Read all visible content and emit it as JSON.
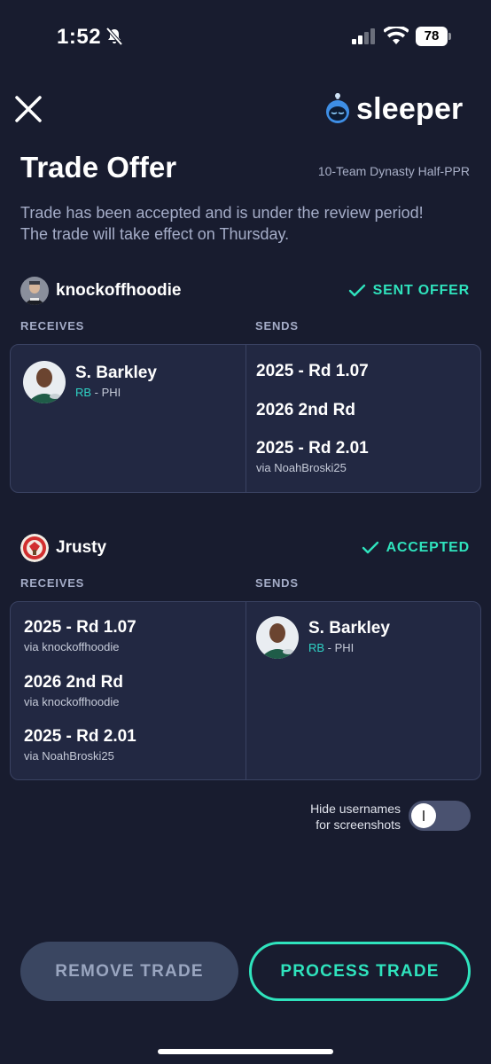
{
  "status_bar": {
    "time": "1:52",
    "battery": "78"
  },
  "header": {
    "logo_text": "sleeper"
  },
  "page": {
    "title": "Trade Offer",
    "league": "10-Team Dynasty Half-PPR",
    "message": "Trade has been accepted and is under the review period! The trade will take effect on Thursday."
  },
  "team1": {
    "name": "knockoffhoodie",
    "status": "SENT OFFER",
    "receives_label": "RECEIVES",
    "sends_label": "SENDS",
    "receives": [
      {
        "name": "S. Barkley",
        "position": "RB",
        "team": " - PHI"
      }
    ],
    "sends": [
      {
        "name": "2025 - Rd 1.07",
        "via": ""
      },
      {
        "name": "2026 2nd Rd",
        "via": ""
      },
      {
        "name": "2025 - Rd 2.01",
        "via": "via NoahBroski25"
      }
    ]
  },
  "team2": {
    "name": "Jrusty",
    "status": "ACCEPTED",
    "receives_label": "RECEIVES",
    "sends_label": "SENDS",
    "receives": [
      {
        "name": "2025 - Rd 1.07",
        "via": "via knockoffhoodie"
      },
      {
        "name": "2026 2nd Rd",
        "via": "via knockoffhoodie"
      },
      {
        "name": "2025 - Rd 2.01",
        "via": "via NoahBroski25"
      }
    ],
    "sends": [
      {
        "name": "S. Barkley",
        "position": "RB",
        "team": " - PHI"
      }
    ]
  },
  "toggle": {
    "line1": "Hide usernames",
    "line2": "for screenshots",
    "on": false
  },
  "buttons": {
    "remove": "REMOVE TRADE",
    "process": "PROCESS TRADE"
  },
  "colors": {
    "background": "#181c2f",
    "accent": "#2fe3bd",
    "card": "#222842",
    "position": "#2fd3c5"
  }
}
